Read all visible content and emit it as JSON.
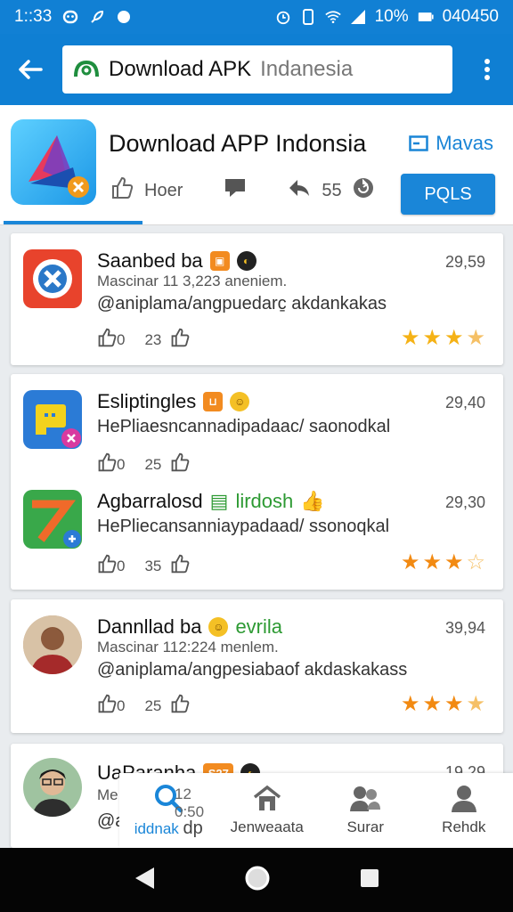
{
  "status_bar": {
    "time": "1::33",
    "battery_percent": "10%",
    "carrier_text": "040450"
  },
  "app_bar": {
    "search_label": "Download APK",
    "search_value": "Indanesia"
  },
  "header": {
    "title": "Download APP Indonsia",
    "link_label": "Mavas",
    "like_label": "Hoer",
    "share_count": "55",
    "install_label": "PQLS"
  },
  "cards": [
    {
      "apps": [
        {
          "name": "Saanbed ba",
          "score": "29,59",
          "subtitle": "Mascinar 11 3,223 aneniem.",
          "description": "@aniplama/angpuedarc̱ akdankakas",
          "like_count": "0",
          "count": "23",
          "rating": 3.5,
          "icon": "shield-x-icon"
        }
      ]
    },
    {
      "apps": [
        {
          "name": "Esliptingles",
          "score": "29,40",
          "subtitle": "",
          "description": "HePliaesncannadipadaac/ saonodkal",
          "like_count": "0",
          "count": "25",
          "rating": null,
          "icon": "chat-bubble-icon"
        },
        {
          "name": "Agbarralosd",
          "tag": "lirdosh",
          "score": "29,30",
          "subtitle": "",
          "description": "HePliecansanniaypadaad/ ssonoqkal",
          "like_count": "0",
          "count": "35",
          "rating": 3.5,
          "icon": "launch-arrow-icon"
        }
      ]
    },
    {
      "apps": [
        {
          "name": "Dannllad ba",
          "tag": "evrila",
          "score": "39,94",
          "subtitle": "Mascinar 112:224 menlem.",
          "description": "@aniplama/angpesiabaof akdaskakass",
          "like_count": "0",
          "count": "25",
          "rating": 3.5,
          "icon": "user-avatar-icon"
        }
      ]
    },
    {
      "apps": [
        {
          "name": "UaParanha",
          "badge": "S27",
          "score": "19,29",
          "subtitle": "Me",
          "description": "@a",
          "rating": null,
          "icon": "user-avatar-icon"
        }
      ]
    }
  ],
  "overlay_text": "12 0:50",
  "bottom_nav": [
    {
      "label": "iddnak",
      "icon": "search-icon",
      "active": true,
      "extra": "dp"
    },
    {
      "label": "Jenweaata",
      "icon": "home-icon",
      "active": false
    },
    {
      "label": "Surar",
      "icon": "users-icon",
      "active": false
    },
    {
      "label": "Rehdk",
      "icon": "profile-icon",
      "active": false
    }
  ],
  "colors": {
    "primary": "#0f7fd3",
    "accent": "#1a86d8",
    "star": "#f28a12"
  }
}
